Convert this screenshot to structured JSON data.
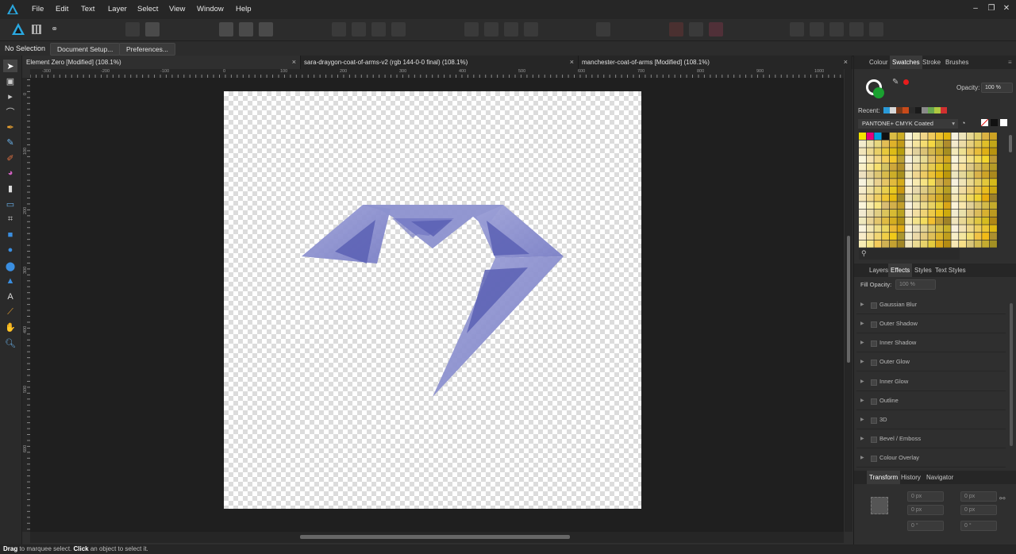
{
  "menu": [
    "File",
    "Edit",
    "Text",
    "Layer",
    "Select",
    "View",
    "Window",
    "Help"
  ],
  "context": {
    "selection": "No Selection",
    "document_setup": "Document Setup...",
    "preferences": "Preferences..."
  },
  "tabs": [
    {
      "label": "Element Zero [Modified] (108.1%)",
      "close": "×"
    },
    {
      "label": "sara-draygon-coat-of-arms-v2 (rgb 144-0-0 final) (108.1%)",
      "close": "×"
    },
    {
      "label": "manchester-coat-of-arms [Modified] (108.1%)",
      "close": "×"
    }
  ],
  "ruler": {
    "h": [
      "-300",
      "-200",
      "-100",
      "0",
      "100",
      "200",
      "300",
      "400",
      "500",
      "600",
      "700",
      "800",
      "900",
      "1000"
    ],
    "v": [
      "0",
      "100",
      "200",
      "300",
      "400",
      "500",
      "600"
    ]
  },
  "color_panel": {
    "tabs": [
      "Colour",
      "Swatches",
      "Stroke",
      "Brushes"
    ],
    "opacity_label": "Opacity:",
    "opacity_value": "100 %",
    "recent_label": "Recent:",
    "palette_name": "PANTONE+ CMYK Coated",
    "colors": {
      "fill": "#1aa130",
      "stroke": "#ffffff",
      "accent": "#e81c1c"
    },
    "recent": [
      "#2a9ad8",
      "#d8d8d8",
      "#7a3a1a",
      "#c84a1a",
      "#2a2a2a",
      "#1a1a1a",
      "#8a8a8a",
      "#6aa84f",
      "#b0c840",
      "#d03030"
    ]
  },
  "effects_panel": {
    "tabs": [
      "Layers",
      "Effects",
      "Styles",
      "Text Styles"
    ],
    "fill_opacity_label": "Fill Opacity:",
    "fill_opacity_value": "100 %",
    "effects": [
      "Gaussian Blur",
      "Outer Shadow",
      "Inner Shadow",
      "Outer Glow",
      "Inner Glow",
      "Outline",
      "3D",
      "Bevel / Emboss",
      "Colour Overlay"
    ]
  },
  "transform_panel": {
    "tabs": [
      "Transform",
      "History",
      "Navigator"
    ],
    "fields": [
      "0 px",
      "0 px",
      "0 px",
      "0 px"
    ],
    "angles": [
      "0 °",
      "0 °"
    ]
  },
  "status": {
    "drag": "Drag",
    "t1": " to marquee select. ",
    "click": "Click",
    "t2": " an object to select it."
  }
}
